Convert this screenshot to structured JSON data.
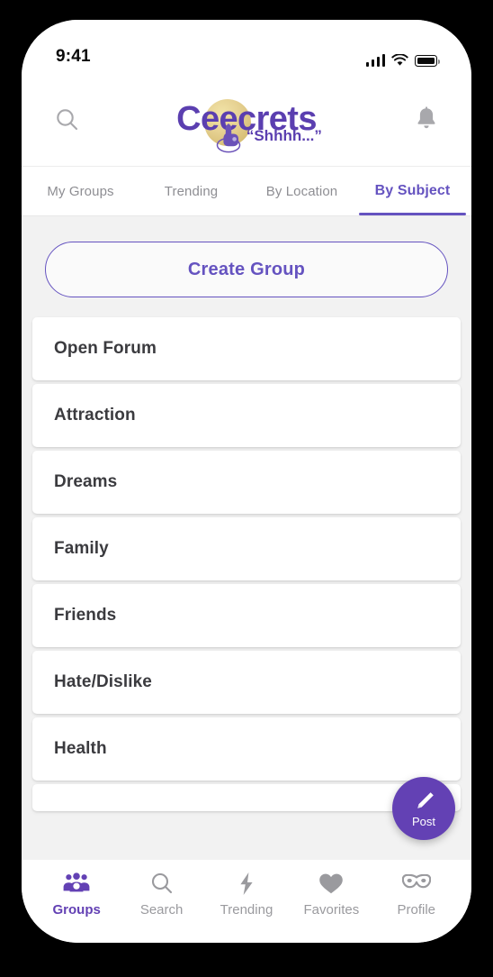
{
  "theme": {
    "accent_purple": "#6341b4",
    "tab_purple": "#6553c0",
    "logo_purple": "#5b3fb0",
    "logo_gold": "#e6d192",
    "body_background": "#f2f2f2",
    "card_background": "#ffffff",
    "muted_text": "#8e8e93"
  },
  "status_bar": {
    "time": "9:41",
    "signal_icon": "cellular-bars-icon",
    "wifi_icon": "wifi-icon",
    "battery_icon": "battery-full-icon"
  },
  "header": {
    "search_icon": "search-icon",
    "notifications_icon": "bell-icon",
    "logo": {
      "text_start": "C",
      "text_middle": "ee",
      "text_end": "crets",
      "full_text": "Ceecrets",
      "tagline": "“Shhhh...”",
      "mascot_icon": "shush-finger-icon"
    }
  },
  "tabs": [
    {
      "label": "My Groups",
      "active": false
    },
    {
      "label": "Trending",
      "active": false
    },
    {
      "label": "By Location",
      "active": false
    },
    {
      "label": "By Subject",
      "active": true
    }
  ],
  "main": {
    "create_group_label": "Create Group",
    "groups": [
      "Open Forum",
      "Attraction",
      "Dreams",
      "Family",
      "Friends",
      "Hate/Dislike",
      "Health"
    ]
  },
  "fab": {
    "label": "Post",
    "icon": "pen-icon"
  },
  "bottom_nav": [
    {
      "label": "Groups",
      "icon": "people-group-icon",
      "active": true
    },
    {
      "label": "Search",
      "icon": "search-icon",
      "active": false
    },
    {
      "label": "Trending",
      "icon": "lightning-bolt-icon",
      "active": false
    },
    {
      "label": "Favorites",
      "icon": "heart-icon",
      "active": false
    },
    {
      "label": "Profile",
      "icon": "mask-icon",
      "active": false
    }
  ]
}
